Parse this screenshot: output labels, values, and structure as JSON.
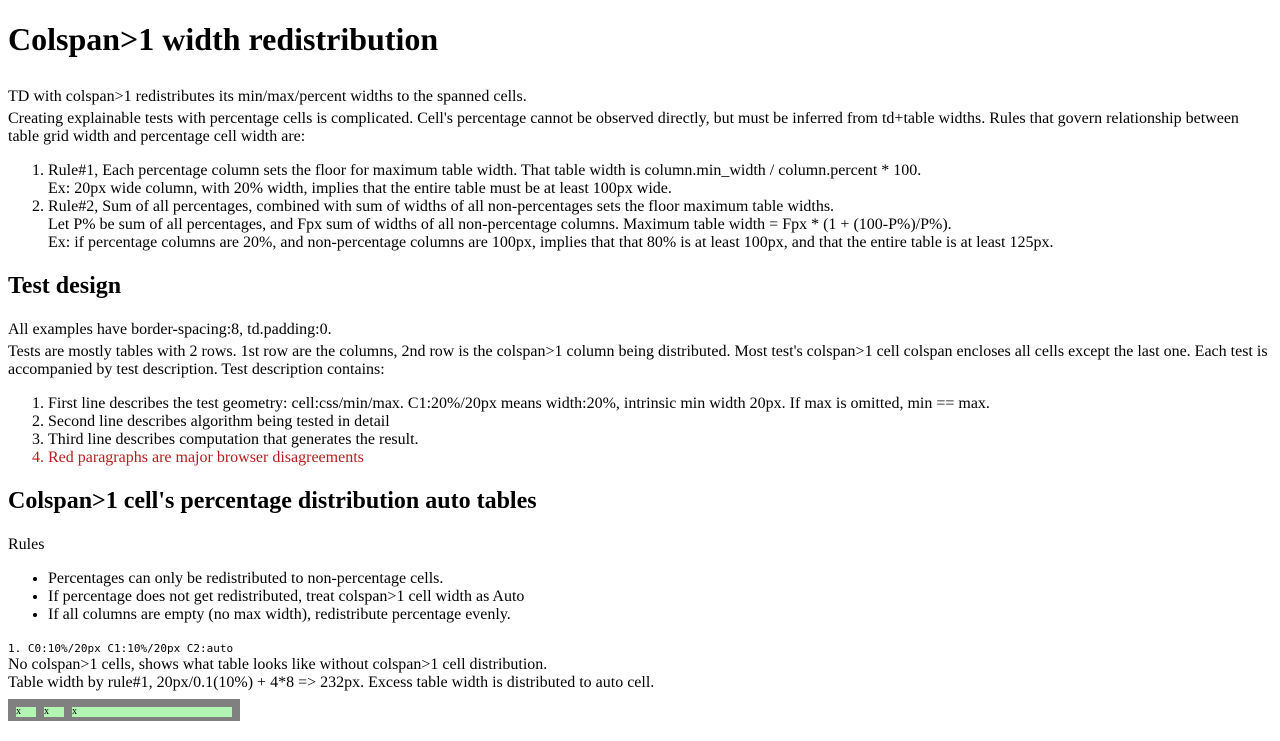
{
  "title": "Colspan>1 width redistribution",
  "intro": {
    "line1": "TD with colspan>1 redistributes its min/max/percent widths to the spanned cells.",
    "line2": "Creating explainable tests with percentage cells is complicated. Cell's percentage cannot be observed directly, but must be inferred from td+table widths. Rules that govern relationship between table grid width and percentage cell width are:",
    "rules": [
      {
        "lines": [
          "Rule#1, Each percentage column sets the floor for maximum table width. That table width is column.min_width / column.percent * 100.",
          "Ex: 20px wide column, with 20% width, implies that the entire table must be at least 100px wide."
        ]
      },
      {
        "lines": [
          "Rule#2, Sum of all percentages, combined with sum of widths of all non-percentages sets the floor maximum table widths.",
          "Let P% be sum of all percentages, and Fpx sum of widths of all non-percentage columns. Maximum table width = Fpx * (1 + (100-P%)/P%).",
          "Ex: if percentage columns are 20%, and non-percentage columns are 100px, implies that that 80% is at least 100px, and that the entire table is at least 125px."
        ]
      }
    ]
  },
  "test_design": {
    "heading": "Test design",
    "line1": "All examples have border-spacing:8, td.padding:0.",
    "line2": "Tests are mostly tables with 2 rows. 1st row are the columns, 2nd row is the colspan>1 column being distributed. Most test's colspan>1 cell colspan encloses all cells except the last one. Each test is accompanied by test description. Test description contains:",
    "items": [
      "First line describes the test geometry: cell:css/min/max. C1:20%/20px means width:20%, intrinsic min width 20px. If max is omitted, min == max.",
      "Second line describes algorithm being tested in detail",
      "Third line describes computation that generates the result.",
      "Red paragraphs are major browser disagreements"
    ]
  },
  "auto_tables": {
    "heading": "Colspan>1 cell's percentage distribution auto tables",
    "rules_label": "Rules",
    "rules": [
      "Percentages can only be redistributed to non-percentage cells.",
      "If percentage does not get redistributed, treat colspan>1 cell width as Auto",
      "If all columns are empty (no max width), redistribute percentage evenly."
    ]
  },
  "test1": {
    "geometry": "1. C0:10%/20px C1:10%/20px C2:auto",
    "line2": "No colspan>1 cells, shows what table looks like without colspan>1 cell distribution.",
    "line3": "Table width by rule#1, 20px/0.1(10%) + 4*8 => 232px. Excess table width is distributed to auto cell.",
    "cells": [
      "x",
      "x",
      "x"
    ]
  },
  "colors": {
    "red_text": "#b71c1c",
    "table_bg": "#808080",
    "cell_bg": "#b3f5b3"
  }
}
